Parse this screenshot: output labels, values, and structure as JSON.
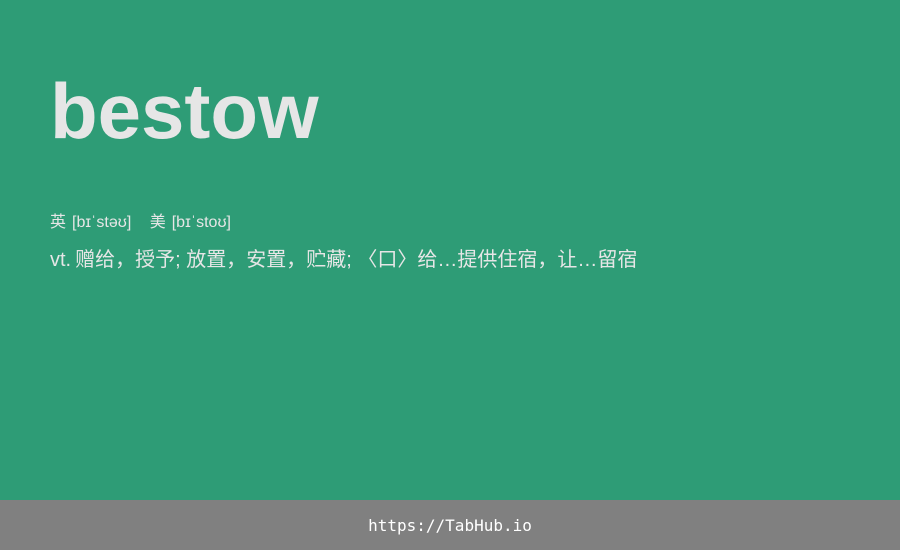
{
  "word": "bestow",
  "phonetics": {
    "uk_label": "英",
    "uk_ipa": "[bɪˈstəʊ]",
    "us_label": "美",
    "us_ipa": "[bɪˈstoʊ]"
  },
  "definition": {
    "pos": "vt.",
    "text": "赠给，授予; 放置，安置，贮藏; 〈口〉给…提供住宿，让…留宿"
  },
  "footer": {
    "link_text": "https://TabHub.io"
  },
  "colors": {
    "background": "#2e9c76",
    "text": "#e6e6e6",
    "footer_bg": "#808080",
    "footer_text": "#ffffff"
  }
}
